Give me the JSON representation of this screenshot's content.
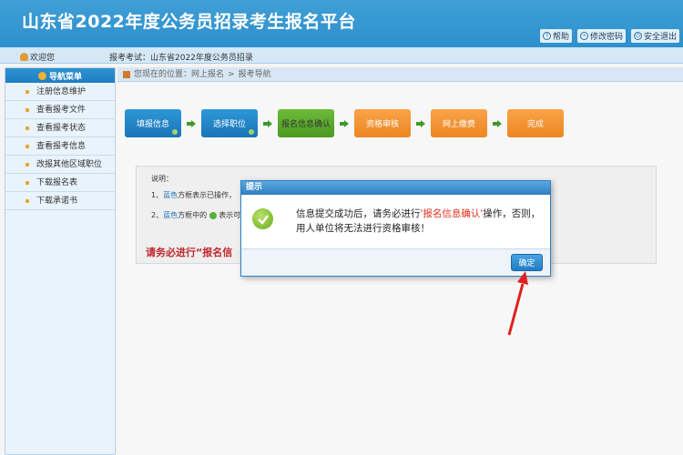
{
  "header": {
    "title": "山东省2022年度公务员招录考生报名平台",
    "links": [
      {
        "label": "帮助",
        "icon": "help-icon"
      },
      {
        "label": "修改密码",
        "icon": "key-icon"
      },
      {
        "label": "安全退出",
        "icon": "power-icon"
      }
    ]
  },
  "userbar": {
    "welcome": "欢迎您",
    "exam": "报考考试：山东省2022年度公务员招录"
  },
  "sidebar": {
    "heading": "导航菜单",
    "items": [
      {
        "label": "注册信息维护"
      },
      {
        "label": "查看报考文件"
      },
      {
        "label": "查看报考状态"
      },
      {
        "label": "查看报考信息"
      },
      {
        "label": "改报其他区域职位"
      },
      {
        "label": "下载报名表"
      },
      {
        "label": "下载承诺书"
      }
    ]
  },
  "breadcrumb": {
    "prefix": "您现在的位置：网上报名",
    "sep": ">",
    "current": "报考导航"
  },
  "steps": [
    {
      "label": "填报信息",
      "color": "blue",
      "done": true
    },
    {
      "label": "选择职位",
      "color": "blue",
      "done": true
    },
    {
      "label": "报名信息确认",
      "color": "green",
      "done": false
    },
    {
      "label": "资格审核",
      "color": "orange",
      "done": false
    },
    {
      "label": "网上缴费",
      "color": "orange",
      "done": false
    },
    {
      "label": "完成",
      "color": "orange",
      "done": false
    }
  ],
  "notice": {
    "heading": "说明：",
    "line1_prefix": "1、",
    "line1_hl": "蓝色",
    "line1_rest": "方框表示已操作，",
    "line2_prefix": "2、",
    "line2_hl": "蓝色",
    "line2_rest": "方框中的",
    "line2_tail": "表示可",
    "warning": "请务必进行“报名信"
  },
  "dialog": {
    "title": "提示",
    "msg_before": "信息提交成功后，请务必进行",
    "msg_highlight": "'报名信息确认'",
    "msg_after": "操作，否则，用人单位将无法进行资格审核！",
    "ok_label": "确定"
  },
  "colors": {
    "header_blue": "#2e8fcc",
    "highlight_red": "#e0301e",
    "warning_red": "#c0262c"
  }
}
